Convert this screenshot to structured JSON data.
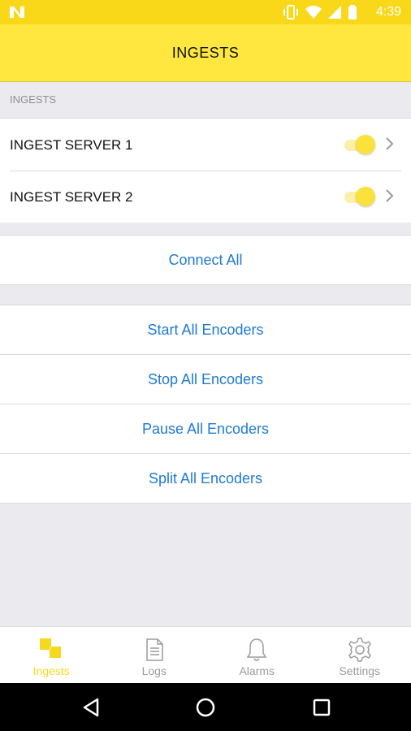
{
  "status_bar": {
    "time": "4:39",
    "icons": [
      "n-logo-icon",
      "vibrate-icon",
      "wifi-icon",
      "signal-icon",
      "battery-icon"
    ]
  },
  "header": {
    "title": "INGESTS"
  },
  "ingests_section": {
    "header": "INGESTS",
    "servers": [
      {
        "label": "INGEST SERVER 1",
        "enabled": true
      },
      {
        "label": "INGEST SERVER 2",
        "enabled": true
      }
    ]
  },
  "connect": {
    "label": "Connect All"
  },
  "encoder_actions": [
    {
      "label": "Start All Encoders"
    },
    {
      "label": "Stop All Encoders"
    },
    {
      "label": "Pause All Encoders"
    },
    {
      "label": "Split All Encoders"
    }
  ],
  "tab_bar": {
    "tabs": [
      {
        "label": "Ingests",
        "icon": "ingests-icon",
        "active": true
      },
      {
        "label": "Logs",
        "icon": "logs-icon",
        "active": false
      },
      {
        "label": "Alarms",
        "icon": "bell-icon",
        "active": false
      },
      {
        "label": "Settings",
        "icon": "gear-icon",
        "active": false
      }
    ]
  },
  "nav_bar": {
    "buttons": [
      "back-icon",
      "home-icon",
      "recents-icon"
    ]
  },
  "colors": {
    "status_bar": "#f9d81a",
    "header": "#ffe73f",
    "accent_yellow": "#fbe23b",
    "link_blue": "#1f7ad4",
    "background": "#ebebef"
  }
}
